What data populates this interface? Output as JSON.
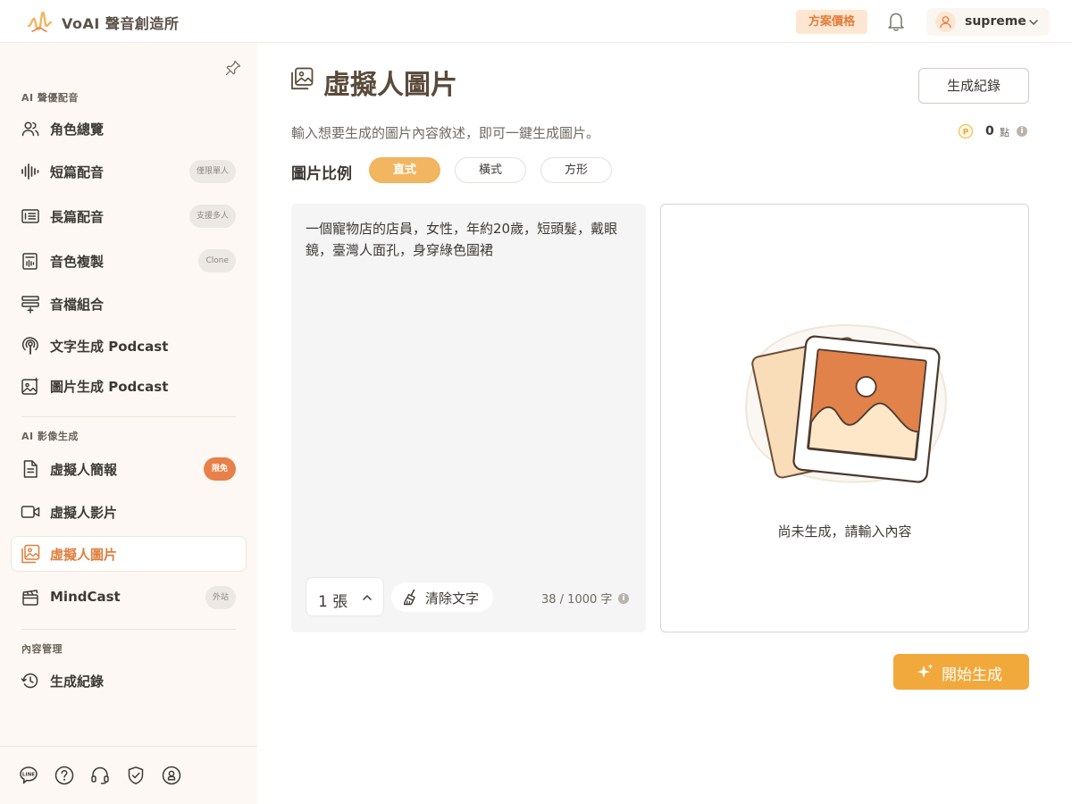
{
  "header": {
    "brand": "VoAI 聲音創造所",
    "pricing_label": "方案價格",
    "username": "supreme"
  },
  "sidebar": {
    "sections": [
      {
        "label": "AI 聲優配音",
        "items": [
          {
            "label": "角色總覽",
            "icon": "users-icon"
          },
          {
            "label": "短篇配音",
            "icon": "waveform-icon",
            "badge": "僅限單人"
          },
          {
            "label": "長篇配音",
            "icon": "document-lines-icon",
            "badge": "支援多人"
          },
          {
            "label": "音色複製",
            "icon": "voice-clone-icon",
            "badge": "Clone"
          },
          {
            "label": "音檔組合",
            "icon": "audio-merge-icon"
          },
          {
            "label": "文字生成 Podcast",
            "icon": "podcast-icon"
          },
          {
            "label": "圖片生成 Podcast",
            "icon": "image-sparkle-icon"
          }
        ]
      },
      {
        "label": "AI 影像生成",
        "items": [
          {
            "label": "虛擬人簡報",
            "icon": "file-icon",
            "badge": "限免"
          },
          {
            "label": "虛擬人影片",
            "icon": "video-icon"
          },
          {
            "label": "虛擬人圖片",
            "icon": "gallery-icon",
            "active": true
          },
          {
            "label": "MindCast",
            "icon": "clapper-icon",
            "badge": "外站"
          }
        ]
      },
      {
        "label": "內容管理",
        "items": [
          {
            "label": "生成紀錄",
            "icon": "history-icon"
          }
        ]
      }
    ],
    "footer_icons": [
      "line-icon",
      "help-icon",
      "headset-icon",
      "shield-icon",
      "account-icon"
    ]
  },
  "main": {
    "title": "虛擬人圖片",
    "history_button": "生成紀錄",
    "subtitle": "輸入想要生成的圖片內容敘述，即可一鍵生成圖片。",
    "points": {
      "value": "0",
      "unit": "點"
    },
    "ratio": {
      "label": "圖片比例",
      "options": [
        "直式",
        "橫式",
        "方形"
      ],
      "selected": "直式"
    },
    "prompt": {
      "value": "一個寵物店的店員，女性，年約20歲，短頭髮，戴眼鏡，臺灣人面孔，身穿綠色圍裙",
      "count_label": "1 張",
      "clear_label": "清除文字",
      "char_count": "38 / 1000 字"
    },
    "preview": {
      "empty_text": "尚未生成，請輸入內容"
    },
    "generate_button": "開始生成"
  },
  "colors": {
    "accent": "#f2a93b",
    "accent_orange": "#e07d3c",
    "sidebar_bg": "#fdf8f3",
    "pricing_bg": "#fde7d2"
  }
}
